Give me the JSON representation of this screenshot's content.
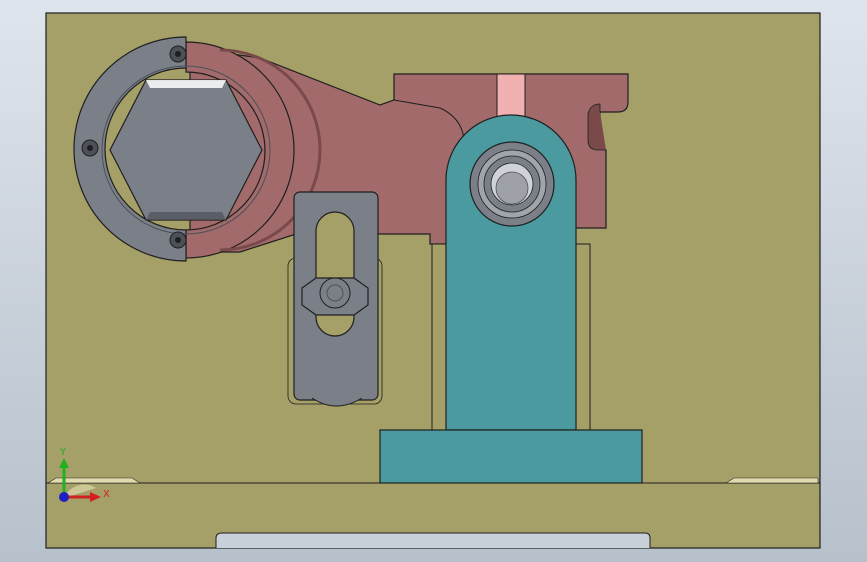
{
  "viewport": {
    "background_top": "#dfe5ec",
    "background_bottom": "#b7c1cc"
  },
  "colors": {
    "base_plate": "#a59f68",
    "arm": "#a26a6a",
    "arm_dark": "#7a4a4a",
    "bracket": "#4a9aa0",
    "bracket_dark": "#2f6f74",
    "steel": "#7b7f88",
    "steel_dark": "#4d5058",
    "outline": "#1f1f1f"
  },
  "triad": {
    "x_label": "X",
    "y_label": "Y",
    "x_color": "#d02020",
    "y_color": "#20b020",
    "z_color": "#2020c0"
  }
}
